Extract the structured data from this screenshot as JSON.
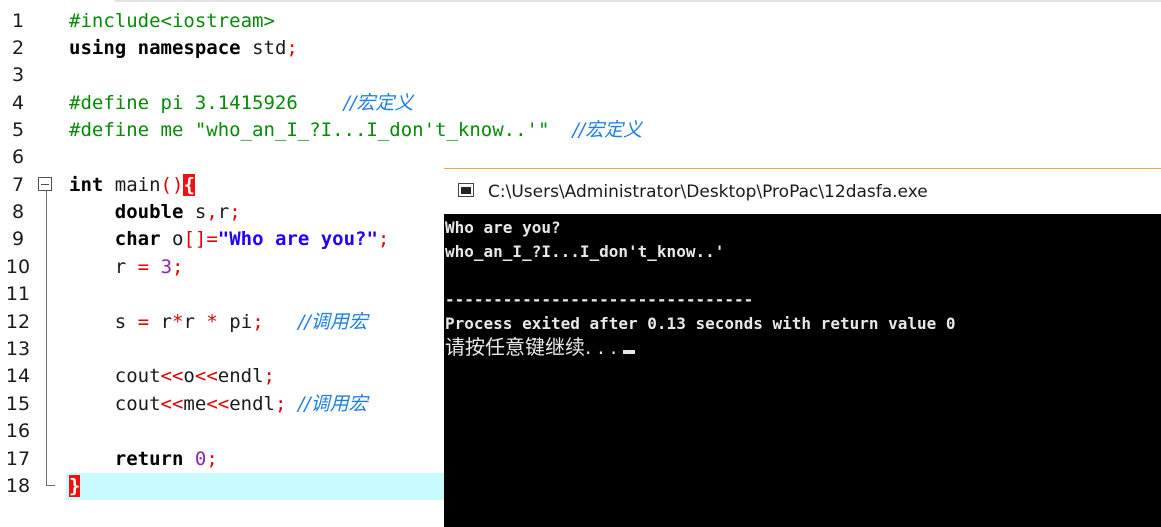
{
  "editor": {
    "line_numbers": [
      "1",
      "2",
      "3",
      "4",
      "5",
      "6",
      "7",
      "8",
      "9",
      "10",
      "11",
      "12",
      "13",
      "14",
      "15",
      "16",
      "17",
      "18"
    ],
    "l1": {
      "pp": "#include<iostream>"
    },
    "l2": {
      "kw1": "using",
      "kw2": "namespace",
      "id": "std",
      "semi": ";"
    },
    "l4": {
      "pp": "#define pi 3.1415926",
      "cmt": "//宏定义"
    },
    "l5": {
      "pp": "#define me \"who_an_I_?I...I_don't_know..'\"",
      "cmt": "//宏定义"
    },
    "l7": {
      "kw": "int",
      "id": "main",
      "paren": "()",
      "brace": "{"
    },
    "l8": {
      "kw": "double",
      "ids": "s",
      "comma": ",",
      "idr": "r",
      "semi": ";"
    },
    "l9": {
      "kw": "char",
      "id": "o",
      "op": "[]=",
      "str": "\"Who are you?\"",
      "semi": ";"
    },
    "l10": {
      "id": "r",
      "op": "=",
      "num": "3",
      "semi": ";"
    },
    "l12": {
      "id1": "s",
      "op1": "=",
      "id2": "r",
      "op2": "*",
      "id3": "r",
      "op3": "*",
      "id4": "pi",
      "semi": ";",
      "cmt": "//调用宏"
    },
    "l14": {
      "id1": "cout",
      "op1": "<<",
      "id2": "o",
      "op2": "<<",
      "id3": "endl",
      "semi": ";"
    },
    "l15": {
      "id1": "cout",
      "op1": "<<",
      "id2": "me",
      "op2": "<<",
      "id3": "endl",
      "semi": ";",
      "cmt": "//调用宏"
    },
    "l17": {
      "kw": "return",
      "num": "0",
      "semi": ";"
    },
    "l18": {
      "brace": "}"
    }
  },
  "console": {
    "title": "C:\\Users\\Administrator\\Desktop\\ProPac\\12dasfa.exe",
    "lines": [
      "Who are you?",
      "who_an_I_?I...I_don't_know..'",
      "",
      "--------------------------------",
      "Process exited after 0.13 seconds with return value 0",
      "请按任意键继续. . ."
    ]
  },
  "colors": {
    "preprocessor": "#078a07",
    "keyword": "#000000",
    "operator": "#e00000",
    "number": "#9023b3",
    "string": "#2000ff",
    "comment": "#1f7fde",
    "current_line": "#c8fafe",
    "console_bg": "#000000"
  }
}
